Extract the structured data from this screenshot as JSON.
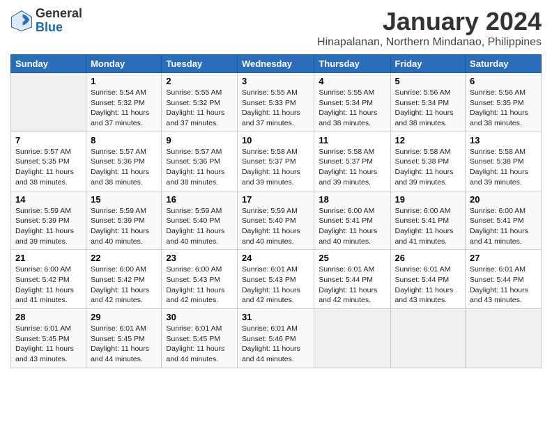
{
  "header": {
    "logo_general": "General",
    "logo_blue": "Blue",
    "title": "January 2024",
    "subtitle": "Hinapalanan, Northern Mindanao, Philippines"
  },
  "weekdays": [
    "Sunday",
    "Monday",
    "Tuesday",
    "Wednesday",
    "Thursday",
    "Friday",
    "Saturday"
  ],
  "weeks": [
    [
      {
        "day": "",
        "info": ""
      },
      {
        "day": "1",
        "info": "Sunrise: 5:54 AM\nSunset: 5:32 PM\nDaylight: 11 hours\nand 37 minutes."
      },
      {
        "day": "2",
        "info": "Sunrise: 5:55 AM\nSunset: 5:32 PM\nDaylight: 11 hours\nand 37 minutes."
      },
      {
        "day": "3",
        "info": "Sunrise: 5:55 AM\nSunset: 5:33 PM\nDaylight: 11 hours\nand 37 minutes."
      },
      {
        "day": "4",
        "info": "Sunrise: 5:55 AM\nSunset: 5:34 PM\nDaylight: 11 hours\nand 38 minutes."
      },
      {
        "day": "5",
        "info": "Sunrise: 5:56 AM\nSunset: 5:34 PM\nDaylight: 11 hours\nand 38 minutes."
      },
      {
        "day": "6",
        "info": "Sunrise: 5:56 AM\nSunset: 5:35 PM\nDaylight: 11 hours\nand 38 minutes."
      }
    ],
    [
      {
        "day": "7",
        "info": "Sunrise: 5:57 AM\nSunset: 5:35 PM\nDaylight: 11 hours\nand 38 minutes."
      },
      {
        "day": "8",
        "info": "Sunrise: 5:57 AM\nSunset: 5:36 PM\nDaylight: 11 hours\nand 38 minutes."
      },
      {
        "day": "9",
        "info": "Sunrise: 5:57 AM\nSunset: 5:36 PM\nDaylight: 11 hours\nand 38 minutes."
      },
      {
        "day": "10",
        "info": "Sunrise: 5:58 AM\nSunset: 5:37 PM\nDaylight: 11 hours\nand 39 minutes."
      },
      {
        "day": "11",
        "info": "Sunrise: 5:58 AM\nSunset: 5:37 PM\nDaylight: 11 hours\nand 39 minutes."
      },
      {
        "day": "12",
        "info": "Sunrise: 5:58 AM\nSunset: 5:38 PM\nDaylight: 11 hours\nand 39 minutes."
      },
      {
        "day": "13",
        "info": "Sunrise: 5:58 AM\nSunset: 5:38 PM\nDaylight: 11 hours\nand 39 minutes."
      }
    ],
    [
      {
        "day": "14",
        "info": "Sunrise: 5:59 AM\nSunset: 5:39 PM\nDaylight: 11 hours\nand 39 minutes."
      },
      {
        "day": "15",
        "info": "Sunrise: 5:59 AM\nSunset: 5:39 PM\nDaylight: 11 hours\nand 40 minutes."
      },
      {
        "day": "16",
        "info": "Sunrise: 5:59 AM\nSunset: 5:40 PM\nDaylight: 11 hours\nand 40 minutes."
      },
      {
        "day": "17",
        "info": "Sunrise: 5:59 AM\nSunset: 5:40 PM\nDaylight: 11 hours\nand 40 minutes."
      },
      {
        "day": "18",
        "info": "Sunrise: 6:00 AM\nSunset: 5:41 PM\nDaylight: 11 hours\nand 40 minutes."
      },
      {
        "day": "19",
        "info": "Sunrise: 6:00 AM\nSunset: 5:41 PM\nDaylight: 11 hours\nand 41 minutes."
      },
      {
        "day": "20",
        "info": "Sunrise: 6:00 AM\nSunset: 5:41 PM\nDaylight: 11 hours\nand 41 minutes."
      }
    ],
    [
      {
        "day": "21",
        "info": "Sunrise: 6:00 AM\nSunset: 5:42 PM\nDaylight: 11 hours\nand 41 minutes."
      },
      {
        "day": "22",
        "info": "Sunrise: 6:00 AM\nSunset: 5:42 PM\nDaylight: 11 hours\nand 42 minutes."
      },
      {
        "day": "23",
        "info": "Sunrise: 6:00 AM\nSunset: 5:43 PM\nDaylight: 11 hours\nand 42 minutes."
      },
      {
        "day": "24",
        "info": "Sunrise: 6:01 AM\nSunset: 5:43 PM\nDaylight: 11 hours\nand 42 minutes."
      },
      {
        "day": "25",
        "info": "Sunrise: 6:01 AM\nSunset: 5:44 PM\nDaylight: 11 hours\nand 42 minutes."
      },
      {
        "day": "26",
        "info": "Sunrise: 6:01 AM\nSunset: 5:44 PM\nDaylight: 11 hours\nand 43 minutes."
      },
      {
        "day": "27",
        "info": "Sunrise: 6:01 AM\nSunset: 5:44 PM\nDaylight: 11 hours\nand 43 minutes."
      }
    ],
    [
      {
        "day": "28",
        "info": "Sunrise: 6:01 AM\nSunset: 5:45 PM\nDaylight: 11 hours\nand 43 minutes."
      },
      {
        "day": "29",
        "info": "Sunrise: 6:01 AM\nSunset: 5:45 PM\nDaylight: 11 hours\nand 44 minutes."
      },
      {
        "day": "30",
        "info": "Sunrise: 6:01 AM\nSunset: 5:45 PM\nDaylight: 11 hours\nand 44 minutes."
      },
      {
        "day": "31",
        "info": "Sunrise: 6:01 AM\nSunset: 5:46 PM\nDaylight: 11 hours\nand 44 minutes."
      },
      {
        "day": "",
        "info": ""
      },
      {
        "day": "",
        "info": ""
      },
      {
        "day": "",
        "info": ""
      }
    ]
  ]
}
